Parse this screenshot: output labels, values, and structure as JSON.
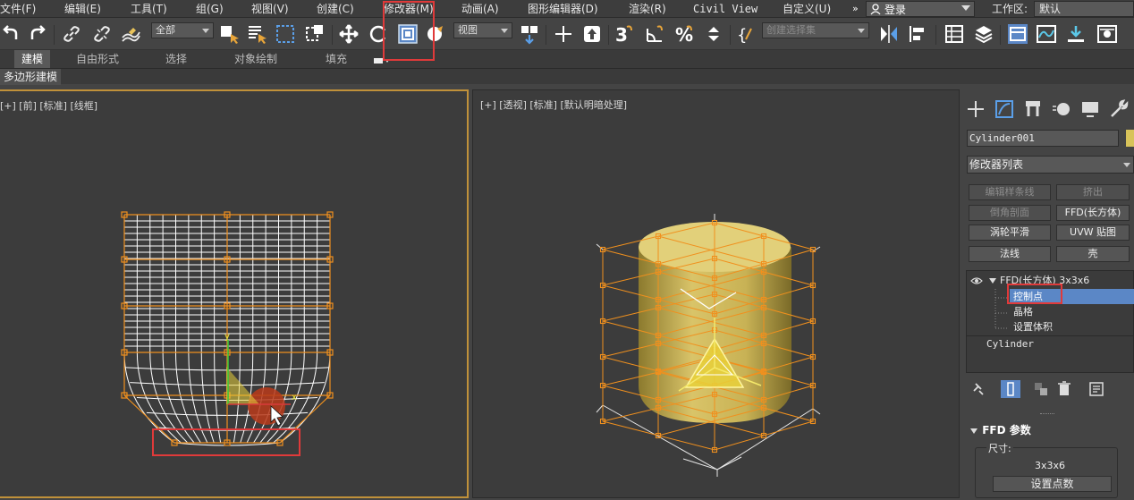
{
  "menubar": {
    "items": [
      "文件(F)",
      "编辑(E)",
      "工具(T)",
      "组(G)",
      "视图(V)",
      "创建(C)",
      "修改器(M)",
      "动画(A)",
      "图形编辑器(D)",
      "渲染(R)",
      "Civil View",
      "自定义(U)"
    ],
    "more": "»",
    "login": "登录",
    "workspace_label": "工作区:",
    "workspace_value": "默认"
  },
  "toolbar": {
    "selection_filter": "全部",
    "reference_coord": "视图",
    "named_selection_placeholder": "创建选择集"
  },
  "ribbon": {
    "tabs": [
      "建模",
      "自由形式",
      "选择",
      "对象绘制",
      "填充"
    ],
    "active_index": 0,
    "subtab": "多边形建模"
  },
  "viewports": {
    "left_label": "[+] [前] [标准] [线框]",
    "right_label": "[+] [透视] [标准] [默认明暗处理]"
  },
  "command_panel": {
    "object_name": "Cylinder001",
    "object_color": "#d8c35a",
    "modifier_list": "修改器列表",
    "modifier_buttons": [
      {
        "label": "编辑样条线",
        "disabled": true
      },
      {
        "label": "挤出",
        "disabled": true
      },
      {
        "label": "倒角剖面",
        "disabled": true
      },
      {
        "label": "FFD(长方体)",
        "disabled": false
      },
      {
        "label": "涡轮平滑",
        "disabled": false
      },
      {
        "label": "UVW 贴图",
        "disabled": false
      },
      {
        "label": "法线",
        "disabled": false
      },
      {
        "label": "壳",
        "disabled": false
      }
    ],
    "stack": {
      "modifier": "FFD(长方体) 3x3x6",
      "sub_items": [
        "控制点",
        "晶格",
        "设置体积"
      ],
      "selected_sub": "控制点",
      "base_object": "Cylinder"
    },
    "params": {
      "header": "FFD 参数",
      "size_label": "尺寸:",
      "size_value": "3x3x6",
      "set_points_button": "设置点数"
    }
  },
  "colors": {
    "highlight_red": "#e03a3a",
    "lattice_orange": "#f0901e",
    "selection_blue": "#5b87c6",
    "cylinder_yellow": "#d8c35a"
  }
}
